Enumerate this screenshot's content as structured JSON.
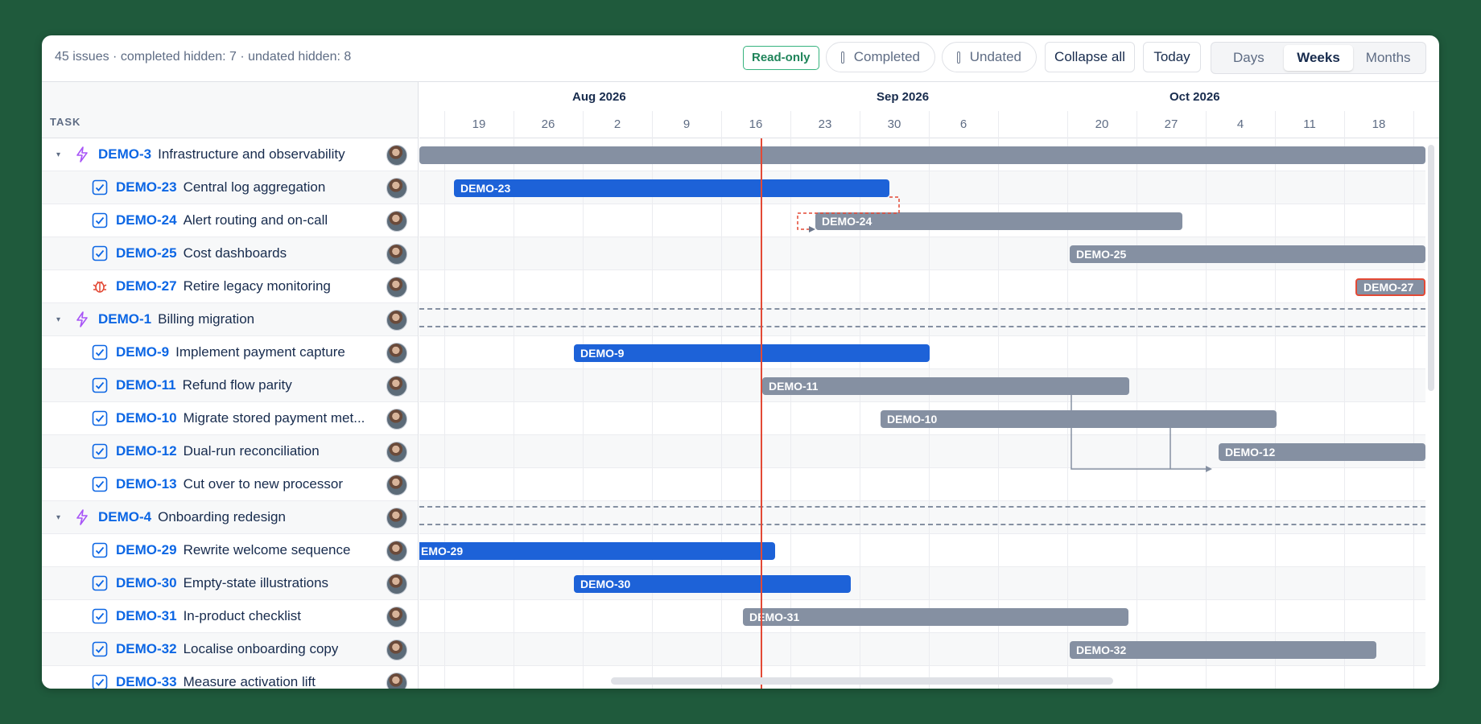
{
  "toolbar": {
    "summary": "45 issues · completed hidden: 7 · undated hidden: 8",
    "readonly_badge": "Read-only",
    "completed_label": "Completed",
    "undated_label": "Undated",
    "collapse_all": "Collapse all",
    "today": "Today",
    "views": [
      "Days",
      "Weeks",
      "Months"
    ],
    "active_view": "Weeks"
  },
  "list_header": "TASK",
  "timeline": {
    "months": [
      "Aug 2026",
      "Sep 2026",
      "Oct 2026"
    ],
    "ticks": [
      "19",
      "26",
      "2",
      "9",
      "16",
      "23",
      "30",
      "6",
      "20",
      "27",
      "4",
      "11",
      "18"
    ]
  },
  "rows": [
    {
      "type": "epic",
      "key": "DEMO-3",
      "title": "Infrastructure and observability"
    },
    {
      "type": "task",
      "key": "DEMO-23",
      "title": "Central log aggregation"
    },
    {
      "type": "task",
      "key": "DEMO-24",
      "title": "Alert routing and on-call"
    },
    {
      "type": "task",
      "key": "DEMO-25",
      "title": "Cost dashboards"
    },
    {
      "type": "bug",
      "key": "DEMO-27",
      "title": "Retire legacy monitoring"
    },
    {
      "type": "epic",
      "key": "DEMO-1",
      "title": "Billing migration"
    },
    {
      "type": "task",
      "key": "DEMO-9",
      "title": "Implement payment capture"
    },
    {
      "type": "task",
      "key": "DEMO-11",
      "title": "Refund flow parity"
    },
    {
      "type": "task",
      "key": "DEMO-10",
      "title": "Migrate stored payment met..."
    },
    {
      "type": "task",
      "key": "DEMO-12",
      "title": "Dual-run reconciliation"
    },
    {
      "type": "task",
      "key": "DEMO-13",
      "title": "Cut over to new processor"
    },
    {
      "type": "epic",
      "key": "DEMO-4",
      "title": "Onboarding redesign"
    },
    {
      "type": "task",
      "key": "DEMO-29",
      "title": "Rewrite welcome sequence"
    },
    {
      "type": "task",
      "key": "DEMO-30",
      "title": "Empty-state illustrations"
    },
    {
      "type": "task",
      "key": "DEMO-31",
      "title": "In-product checklist"
    },
    {
      "type": "task",
      "key": "DEMO-32",
      "title": "Localise onboarding copy"
    },
    {
      "type": "task",
      "key": "DEMO-33",
      "title": "Measure activation lift"
    }
  ],
  "bars": [
    {
      "row": 0,
      "label": "",
      "color": "grey"
    },
    {
      "row": 1,
      "label": "DEMO-23",
      "color": "blue"
    },
    {
      "row": 2,
      "label": "DEMO-24",
      "color": "grey"
    },
    {
      "row": 3,
      "label": "DEMO-25",
      "color": "grey"
    },
    {
      "row": 4,
      "label": "DEMO-27",
      "color": "red"
    },
    {
      "row": 6,
      "label": "DEMO-9",
      "color": "blue"
    },
    {
      "row": 7,
      "label": "DEMO-11",
      "color": "grey"
    },
    {
      "row": 8,
      "label": "DEMO-10",
      "color": "grey"
    },
    {
      "row": 9,
      "label": "DEMO-12",
      "color": "grey"
    },
    {
      "row": 12,
      "label": "EMO-29",
      "color": "blue"
    },
    {
      "row": 13,
      "label": "DEMO-30",
      "color": "blue"
    },
    {
      "row": 14,
      "label": "DEMO-31",
      "color": "grey"
    },
    {
      "row": 15,
      "label": "DEMO-32",
      "color": "grey"
    }
  ],
  "colors": {
    "accent": "#0c66e4",
    "bar_blue": "#1d62d8",
    "bar_grey": "#8590a2",
    "today_line": "#e34935",
    "epic_icon": "#a855f7",
    "bug_icon": "#e34935"
  }
}
